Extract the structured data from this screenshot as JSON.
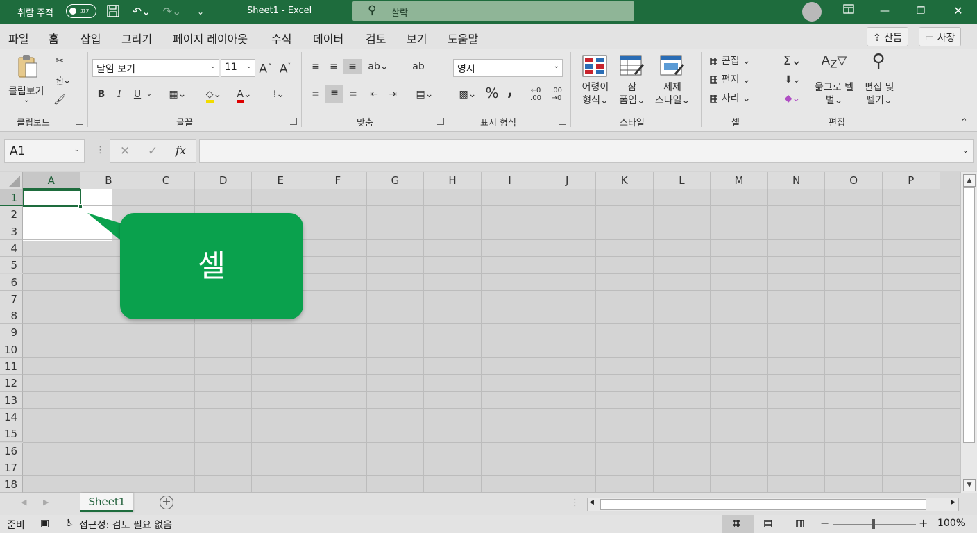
{
  "titlebar": {
    "autosave_label": "취람 주적",
    "toggle_label": "끄기",
    "doc_title": "Sheet1 - Excel",
    "search_placeholder": "살락"
  },
  "menu": {
    "items": [
      "파일",
      "홈",
      "삽입",
      "그리기",
      "페이지 레이아웃",
      "수식",
      "데이터",
      "검토",
      "보기",
      "도움말"
    ],
    "active": "홈",
    "share_label": "산듬",
    "comment_label": "사장"
  },
  "ribbon": {
    "clipboard": {
      "paste_label": "클립보기",
      "group_label": "클립보드"
    },
    "font": {
      "font_name": "달임 보기",
      "font_size": "11",
      "bold": "B",
      "italic": "I",
      "underline": "U",
      "group_label": "글꼴",
      "grow": "A",
      "shrink": "A"
    },
    "alignment": {
      "group_label": "맞춤"
    },
    "number": {
      "format": "영시",
      "percent": "%",
      "comma": ",",
      "inc_decimal": "←0\n.00",
      "dec_decimal": ".00\n→0",
      "group_label": "표시 형식"
    },
    "styles": {
      "conditional_label_1": "어령이",
      "conditional_label_2": "형식",
      "table_label_1": "잠",
      "table_label_2": "폼임",
      "cell_label_1": "세제",
      "cell_label_2": "스타일",
      "group_label": "스타일"
    },
    "cells": {
      "insert_label": "콘집",
      "delete_label": "펀지",
      "format_label": "사리",
      "group_label": "셀"
    },
    "editing": {
      "sort_label_1": "욺그로 텔",
      "sort_label_2": "벌",
      "find_label_1": "편집 및",
      "find_label_2": "펠기",
      "group_label": "편집"
    }
  },
  "formula_bar": {
    "name_box": "A1",
    "fx": "fx",
    "value": ""
  },
  "grid": {
    "columns": [
      "A",
      "B",
      "C",
      "D",
      "E",
      "F",
      "G",
      "H",
      "I",
      "J",
      "K",
      "L",
      "M",
      "N",
      "O",
      "P"
    ],
    "rows": [
      "1",
      "2",
      "3",
      "4",
      "5",
      "6",
      "7",
      "8",
      "9",
      "10",
      "11",
      "12",
      "13",
      "14",
      "15",
      "16",
      "17",
      "18"
    ],
    "active_cell": "A1"
  },
  "callout": {
    "text": "셀"
  },
  "sheet_tabs": {
    "active": "Sheet1"
  },
  "status": {
    "ready": "준비",
    "accessibility": "접근성: 검토 필요 없음",
    "zoom": "100%"
  },
  "colors": {
    "brand": "#1e6c3d",
    "callout": "#0aa14d"
  }
}
